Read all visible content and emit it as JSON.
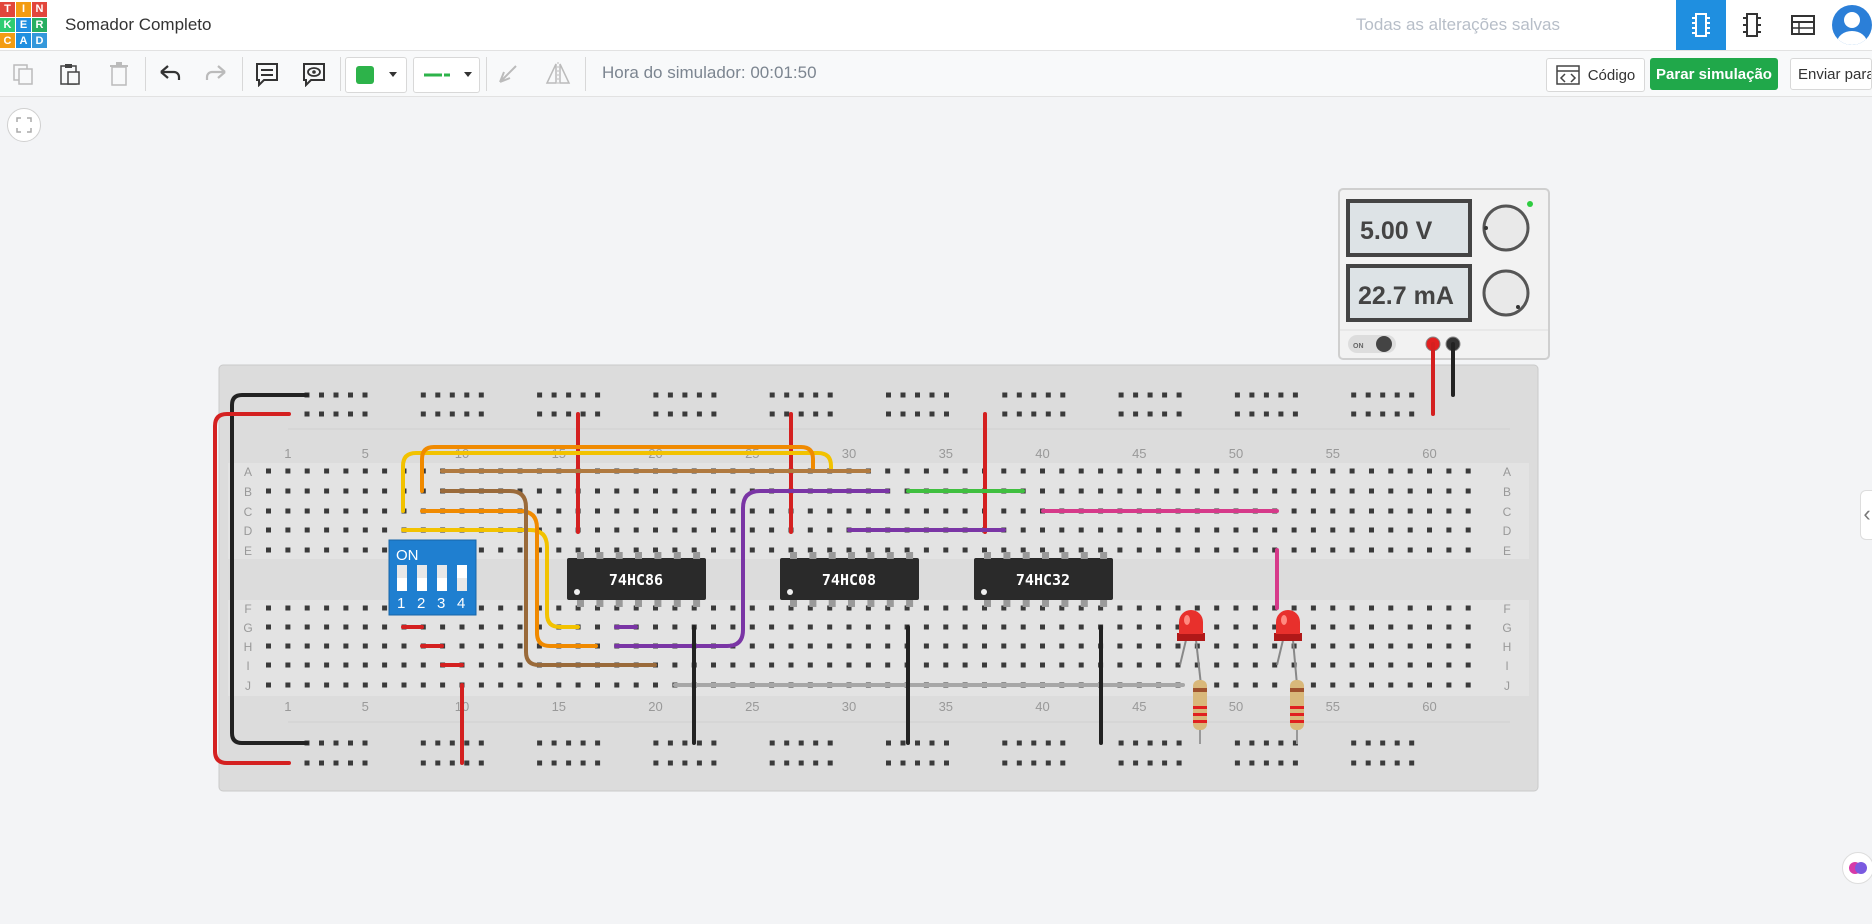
{
  "app": {
    "logo_letters": [
      "T",
      "I",
      "N",
      "K",
      "E",
      "R",
      "C",
      "A",
      "D"
    ],
    "logo_colors": [
      "#e2463b",
      "#f39c12",
      "#e2463b",
      "#2ecc71",
      "#1f8fe0",
      "#27ae60",
      "#f39c12",
      "#1f8fe0",
      "#3498db"
    ],
    "project_title": "Somador Completo",
    "save_status": "Todas as alterações salvas",
    "views": [
      "circuit-view-icon",
      "schematic-view-icon",
      "component-list-icon"
    ]
  },
  "toolbar": {
    "sim_time": "Hora do simulador: 00:01:50",
    "code_label": "Código",
    "stop_label": "Parar simulação",
    "send_label": "Enviar para",
    "wire_color": "#2db34a"
  },
  "power_supply": {
    "voltage": "5.00 V",
    "current": "22.7 mA",
    "on_label": "ON"
  },
  "breadboard": {
    "column_numbers": [
      "1",
      "5",
      "10",
      "15",
      "20",
      "25",
      "30",
      "35",
      "40",
      "45",
      "50",
      "55",
      "60"
    ],
    "rows_top": [
      "A",
      "B",
      "C",
      "D",
      "E"
    ],
    "rows_bottom": [
      "F",
      "G",
      "H",
      "I",
      "J"
    ]
  },
  "dip_switch": {
    "label": "ON",
    "numbers": [
      "1",
      "2",
      "3",
      "4"
    ]
  },
  "chips": [
    {
      "name": "74HC86"
    },
    {
      "name": "74HC08"
    },
    {
      "name": "74HC32"
    }
  ],
  "leds": [
    "#e8302c",
    "#e8302c"
  ]
}
